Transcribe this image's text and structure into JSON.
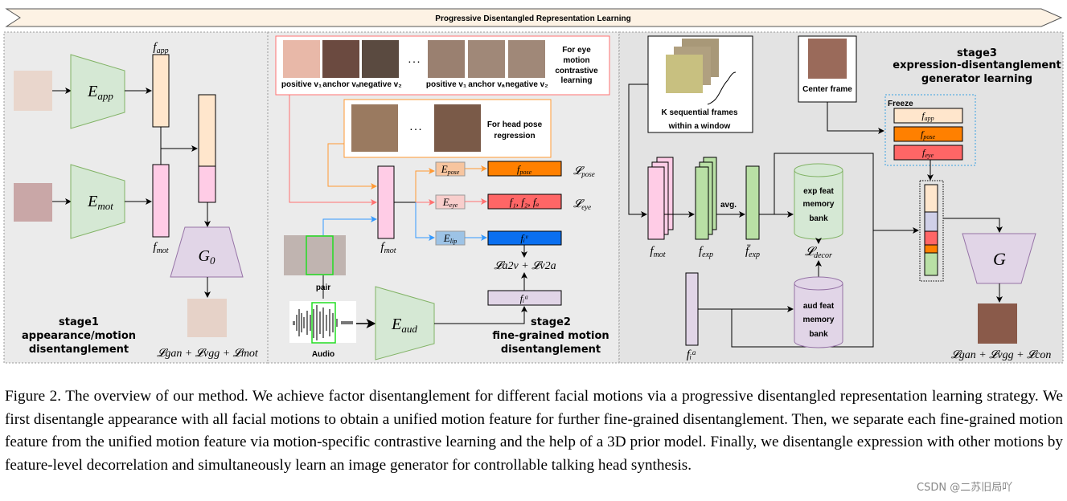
{
  "banner": {
    "title": "Progressive Disentangled Representation Learning"
  },
  "stage1": {
    "title": [
      "stage1",
      "appearance/motion",
      "disentanglement"
    ],
    "e_app": {
      "b": "E",
      "s": "app"
    },
    "e_mot": {
      "b": "E",
      "s": "mot"
    },
    "f_app": {
      "b": "f",
      "s": "app"
    },
    "f_mot": {
      "b": "f",
      "s": "mot"
    },
    "g0": {
      "b": "G",
      "s": "0"
    },
    "loss": "𝓛gan + 𝓛vgg + 𝓛mot"
  },
  "stage2": {
    "title": [
      "stage2",
      "fine-grained motion",
      "disentanglement"
    ],
    "eye_box": {
      "labels": [
        "positive v₁",
        "anchor vₐ",
        "negative v₂",
        "positive v₁",
        "anchor vₐ",
        "negative v₂"
      ],
      "dots": ". . .",
      "text": [
        "For eye",
        "motion",
        "contrastive",
        "learning"
      ]
    },
    "pose_box": {
      "dots": ". . .",
      "text": [
        "For head pose",
        "regression"
      ]
    },
    "f_mot": {
      "b": "f",
      "s": "mot"
    },
    "e_pose": {
      "b": "E",
      "s": "pose"
    },
    "e_eye": {
      "b": "E",
      "s": "eye"
    },
    "e_lip": {
      "b": "E",
      "s": "lip"
    },
    "f_pose": {
      "b": "f",
      "s": "pose"
    },
    "f_eye": "f₁, f₂, fₐ",
    "f_iv": "fᵢᵛ",
    "f_ia": "fᵢᵃ",
    "l_pose": {
      "b": "𝓛",
      "s": "pose"
    },
    "l_eye": {
      "b": "𝓛",
      "s": "eye"
    },
    "l_sync": "𝓛a2v + 𝓛v2a",
    "pair": "pair",
    "audio": "Audio",
    "e_aud": {
      "b": "E",
      "s": "aud"
    }
  },
  "stage3": {
    "title": [
      "stage3",
      "expression-disentanglement",
      "generator learning"
    ],
    "k_frames": [
      "K sequential frames",
      "within a window"
    ],
    "center_frame": "Center frame",
    "freeze": "Freeze",
    "f_app": {
      "b": "f",
      "s": "app"
    },
    "f_pose": {
      "b": "f",
      "s": "pose"
    },
    "f_eye": {
      "b": "f",
      "s": "eye"
    },
    "f_mot": {
      "b": "f",
      "s": "mot"
    },
    "f_exp": {
      "b": "f",
      "s": "exp"
    },
    "f_exp_avg": {
      "b": "f̄",
      "s": "exp"
    },
    "avg": "avg.",
    "exp_bank": [
      "exp feat",
      "memory",
      "bank"
    ],
    "aud_bank": [
      "aud feat",
      "memory",
      "bank"
    ],
    "l_decor": {
      "b": "𝓛",
      "s": "decor"
    },
    "f_ia": "fᵢᵃ",
    "g": "G",
    "loss": "𝓛gan + 𝓛vgg + 𝓛con"
  },
  "caption": "Figure 2.  The overview of our method.  We achieve factor disentanglement for different facial motions via a progressive disentangled representation learning strategy.  We first disentangle appearance with all facial motions to obtain a unified motion feature for further fine-grained disentanglement.  Then, we separate each fine-grained motion feature from the unified motion feature via motion-specific contrastive learning and the help of a 3D prior model. Finally, we disentangle expression with other motions by feature-level decorrelation and simultaneously learn an image generator for controllable talking head synthesis.",
  "watermark": "CSDN @二苏旧局吖",
  "colors": {
    "panel": "#e8e8e8",
    "encoder": "#d5e8d4",
    "peach": "#ffe6cc",
    "pink": "#ffcce6",
    "purple": "#e1d5e7",
    "orange": "#ff8000",
    "red": "#ff6666",
    "blue": "#0a6ff0"
  }
}
